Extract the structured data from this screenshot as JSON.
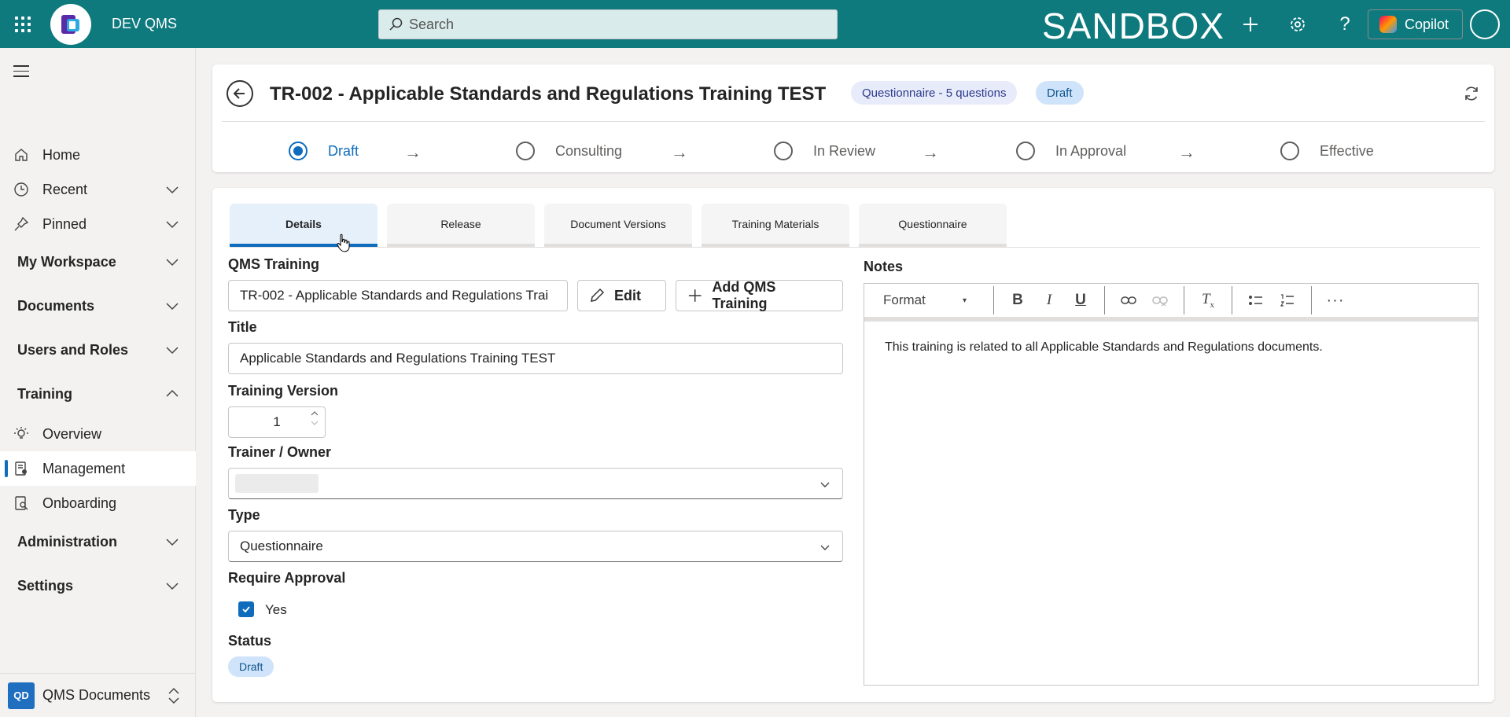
{
  "topbar": {
    "app_name": "DEV QMS",
    "search_placeholder": "Search",
    "env_label": "SANDBOX",
    "copilot_label": "Copilot",
    "icons": [
      "waffle-icon",
      "add-icon",
      "gear-icon",
      "help-icon",
      "copilot-icon"
    ]
  },
  "sidebar": {
    "home": "Home",
    "recent": "Recent",
    "pinned": "Pinned",
    "my_workspace": "My Workspace",
    "documents": "Documents",
    "users_roles": "Users and Roles",
    "training": "Training",
    "overview": "Overview",
    "management": "Management",
    "onboarding": "Onboarding",
    "administration": "Administration",
    "settings": "Settings",
    "area_badge": "QD",
    "area_name": "QMS Documents"
  },
  "header": {
    "title": "TR-002 - Applicable Standards and Regulations Training TEST",
    "questionnaire_pill": "Questionnaire - 5 questions",
    "status_pill": "Draft",
    "stages": [
      "Draft",
      "Consulting",
      "In Review",
      "In Approval",
      "Effective"
    ],
    "active_stage": "Draft"
  },
  "tabs": [
    "Details",
    "Release",
    "Document Versions",
    "Training Materials",
    "Questionnaire"
  ],
  "form": {
    "qms_training_label": "QMS Training",
    "qms_training_value": "TR-002 - Applicable Standards and Regulations Trai",
    "edit_label": "Edit",
    "add_label": "Add QMS Training",
    "title_label": "Title",
    "title_value": "Applicable Standards and Regulations Training TEST",
    "version_label": "Training Version",
    "version_value": "1",
    "owner_label": "Trainer / Owner",
    "type_label": "Type",
    "type_value": "Questionnaire",
    "approval_label": "Require Approval",
    "approval_value": "Yes",
    "status_label": "Status",
    "status_value": "Draft"
  },
  "notes": {
    "label": "Notes",
    "format_label": "Format",
    "text": "This training is related to all Applicable Standards and Regulations documents."
  },
  "colors": {
    "topbar": "#0f7a7e",
    "accent": "#0f6cbd",
    "pill_blue": "#cfe4fa"
  }
}
